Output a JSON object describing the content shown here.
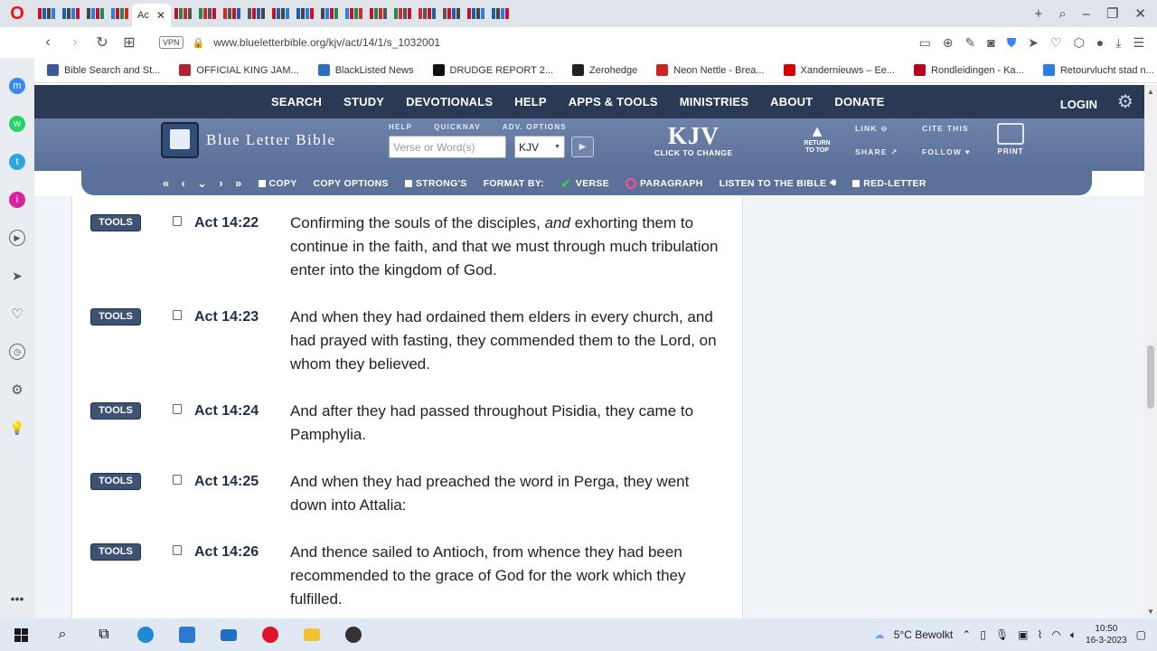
{
  "browser": {
    "active_tab_label": "Ac",
    "url": "www.blueletterbible.org/kjv/act/14/1/s_1032001",
    "vpn_label": "VPN",
    "bookmarks": [
      {
        "label": "Bible Search and St...",
        "color": "#3b5998"
      },
      {
        "label": "OFFICIAL KING JAM...",
        "color": "#b22234"
      },
      {
        "label": "BlackListed News",
        "color": "#2c6fbb"
      },
      {
        "label": "DRUDGE REPORT 2...",
        "color": "#111111"
      },
      {
        "label": "Zerohedge",
        "color": "#222222"
      },
      {
        "label": "Neon Nettle - Brea...",
        "color": "#cc2222"
      },
      {
        "label": "Xandernieuws – Ee...",
        "color": "#d40000"
      },
      {
        "label": "Rondleidingen - Ka...",
        "color": "#b8001f"
      },
      {
        "label": "Retourvlucht stad n...",
        "color": "#2a7de1"
      }
    ]
  },
  "site": {
    "nav": [
      "SEARCH",
      "STUDY",
      "DEVOTIONALS",
      "HELP",
      "APPS & TOOLS",
      "MINISTRIES",
      "ABOUT",
      "DONATE"
    ],
    "login": "LOGIN",
    "logo_text": "Blue Letter Bible",
    "search_labels": [
      "HELP",
      "QUICKNAV",
      "ADV. OPTIONS"
    ],
    "search_placeholder": "Verse or Word(s)",
    "version_select": "KJV",
    "version_big": "KJV",
    "version_sub": "CLICK TO CHANGE",
    "return_top": [
      "RETURN",
      "TO TOP"
    ],
    "link": "LINK",
    "cite": "CITE THIS",
    "share": "SHARE",
    "follow": "FOLLOW",
    "print": "PRINT"
  },
  "verse_toolbar": {
    "copy": "COPY",
    "copy_options": "COPY OPTIONS",
    "strongs": "STRONG'S",
    "format_by": "FORMAT BY:",
    "verse": "VERSE",
    "paragraph": "PARAGRAPH",
    "listen": "LISTEN TO THE BIBLE",
    "red_letter": "RED-LETTER"
  },
  "verses": [
    {
      "tools": "TOOLS",
      "ref": "Act 14:22",
      "lines": [
        "Confirming the souls of the disciples, ",
        "and",
        " exhorting them to continue in the faith, and that we must through much tribulation enter into the kingdom of God."
      ]
    },
    {
      "tools": "TOOLS",
      "ref": "Act 14:23",
      "text": "And when they had ordained them elders in every church, and had prayed with fasting, they commended them to the Lord, on whom they believed."
    },
    {
      "tools": "TOOLS",
      "ref": "Act 14:24",
      "text": "And after they had passed throughout Pisidia, they came to Pamphylia."
    },
    {
      "tools": "TOOLS",
      "ref": "Act 14:25",
      "text": "And when they had preached the word in Perga, they went down into Attalia:"
    },
    {
      "tools": "TOOLS",
      "ref": "Act 14:26",
      "text": "And thence sailed to Antioch, from whence they had been recommended to the grace of God for the work which they fulfilled."
    }
  ],
  "taskbar": {
    "weather": "5°C Bewolkt",
    "time": "10:50",
    "date": "16-3-2023"
  }
}
